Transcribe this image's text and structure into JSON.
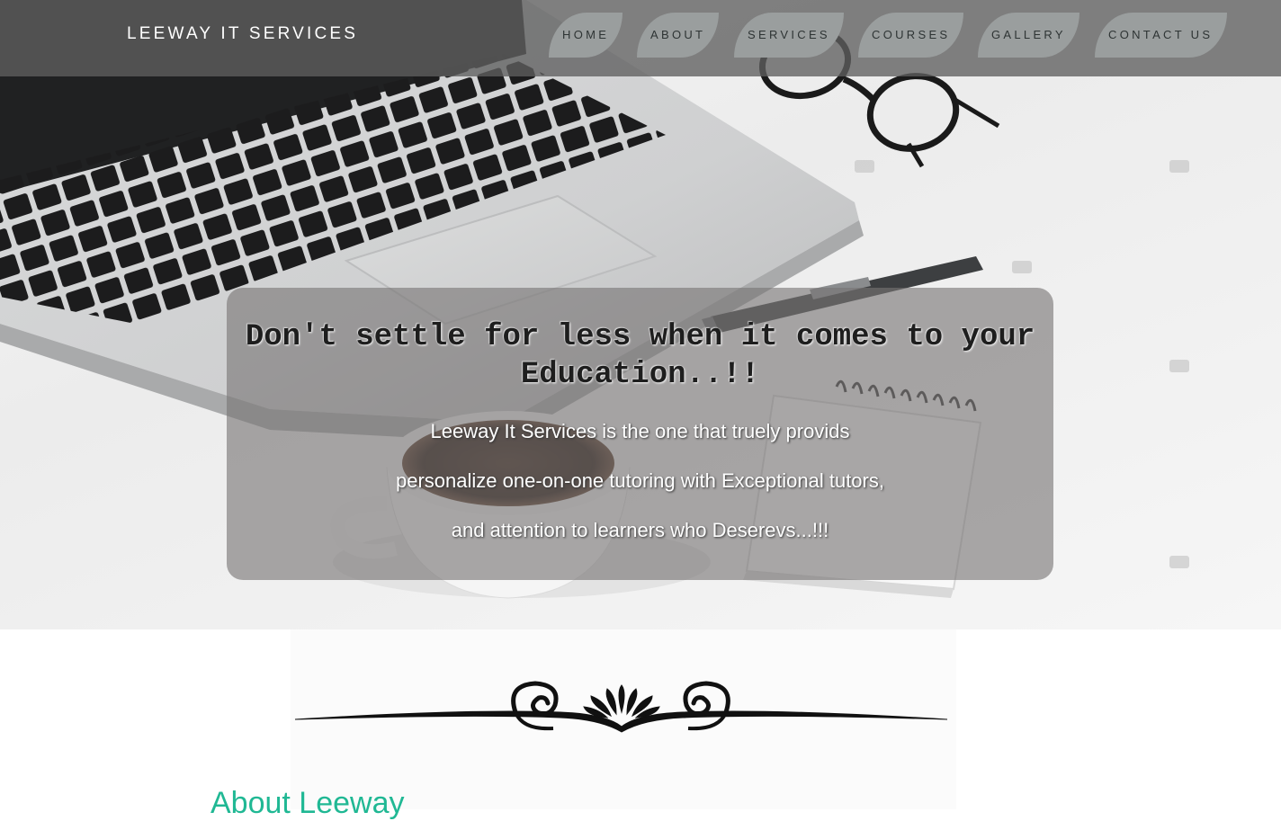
{
  "brand": "LEEWAY IT SERVICES",
  "nav": {
    "home": "HOME",
    "about": "ABOUT",
    "services": "SERVICES",
    "courses": "COURSES",
    "gallery": "GALLERY",
    "contact": "CONTACT US"
  },
  "hero": {
    "heading": "Don't settle for less when it comes to your Education..!!",
    "lines": [
      "Leeway It Services is the one that truely provids",
      "personalize one-on-one tutoring with Exceptional tutors,",
      "and attention to learners who Deserevs...!!!"
    ],
    "background_image": "laptop-coffee-glasses-notebook-photo"
  },
  "about": {
    "title": "About Leeway"
  },
  "colors": {
    "navbar_bg": "#5f5f5f",
    "nav_button_bg": "#9a9e9e",
    "nav_text": "#2e3434",
    "accent": "#20b894",
    "card_bg": "#787474"
  },
  "icons": [
    "ornamental-divider-icon"
  ]
}
